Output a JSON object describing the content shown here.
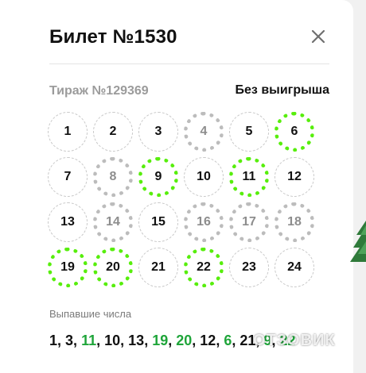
{
  "ticket": {
    "title": "Билет №1530",
    "draw_label": "Тираж №129369",
    "result": "Без выигрыша"
  },
  "numbers": [
    {
      "value": "1",
      "state": "plain"
    },
    {
      "value": "2",
      "state": "plain"
    },
    {
      "value": "3",
      "state": "plain"
    },
    {
      "value": "4",
      "state": "gray"
    },
    {
      "value": "5",
      "state": "plain"
    },
    {
      "value": "6",
      "state": "green"
    },
    {
      "value": "7",
      "state": "plain"
    },
    {
      "value": "8",
      "state": "gray"
    },
    {
      "value": "9",
      "state": "green"
    },
    {
      "value": "10",
      "state": "plain"
    },
    {
      "value": "11",
      "state": "green"
    },
    {
      "value": "12",
      "state": "plain"
    },
    {
      "value": "13",
      "state": "plain"
    },
    {
      "value": "14",
      "state": "gray"
    },
    {
      "value": "15",
      "state": "plain"
    },
    {
      "value": "16",
      "state": "gray"
    },
    {
      "value": "17",
      "state": "gray"
    },
    {
      "value": "18",
      "state": "gray"
    },
    {
      "value": "19",
      "state": "green"
    },
    {
      "value": "20",
      "state": "green"
    },
    {
      "value": "21",
      "state": "plain"
    },
    {
      "value": "22",
      "state": "green"
    },
    {
      "value": "23",
      "state": "plain"
    },
    {
      "value": "24",
      "state": "plain"
    }
  ],
  "drawn": {
    "label": "Выпавшие числа",
    "values": [
      {
        "n": "1",
        "hit": false
      },
      {
        "n": "3",
        "hit": false
      },
      {
        "n": "11",
        "hit": true
      },
      {
        "n": "10",
        "hit": false
      },
      {
        "n": "13",
        "hit": false
      },
      {
        "n": "19",
        "hit": true
      },
      {
        "n": "20",
        "hit": true
      },
      {
        "n": "12",
        "hit": false
      },
      {
        "n": "6",
        "hit": true
      },
      {
        "n": "21",
        "hit": false
      },
      {
        "n": "9",
        "hit": true
      },
      {
        "n": "22",
        "hit": true
      }
    ]
  },
  "watermark": "ОТЗОВИК",
  "colors": {
    "match_green": "#57ee0c",
    "hit_text_green": "#1fa53a",
    "selected_gray": "#bcbcbc"
  },
  "icons": {
    "close": "close-icon",
    "tree": "christmas-tree-icon"
  }
}
